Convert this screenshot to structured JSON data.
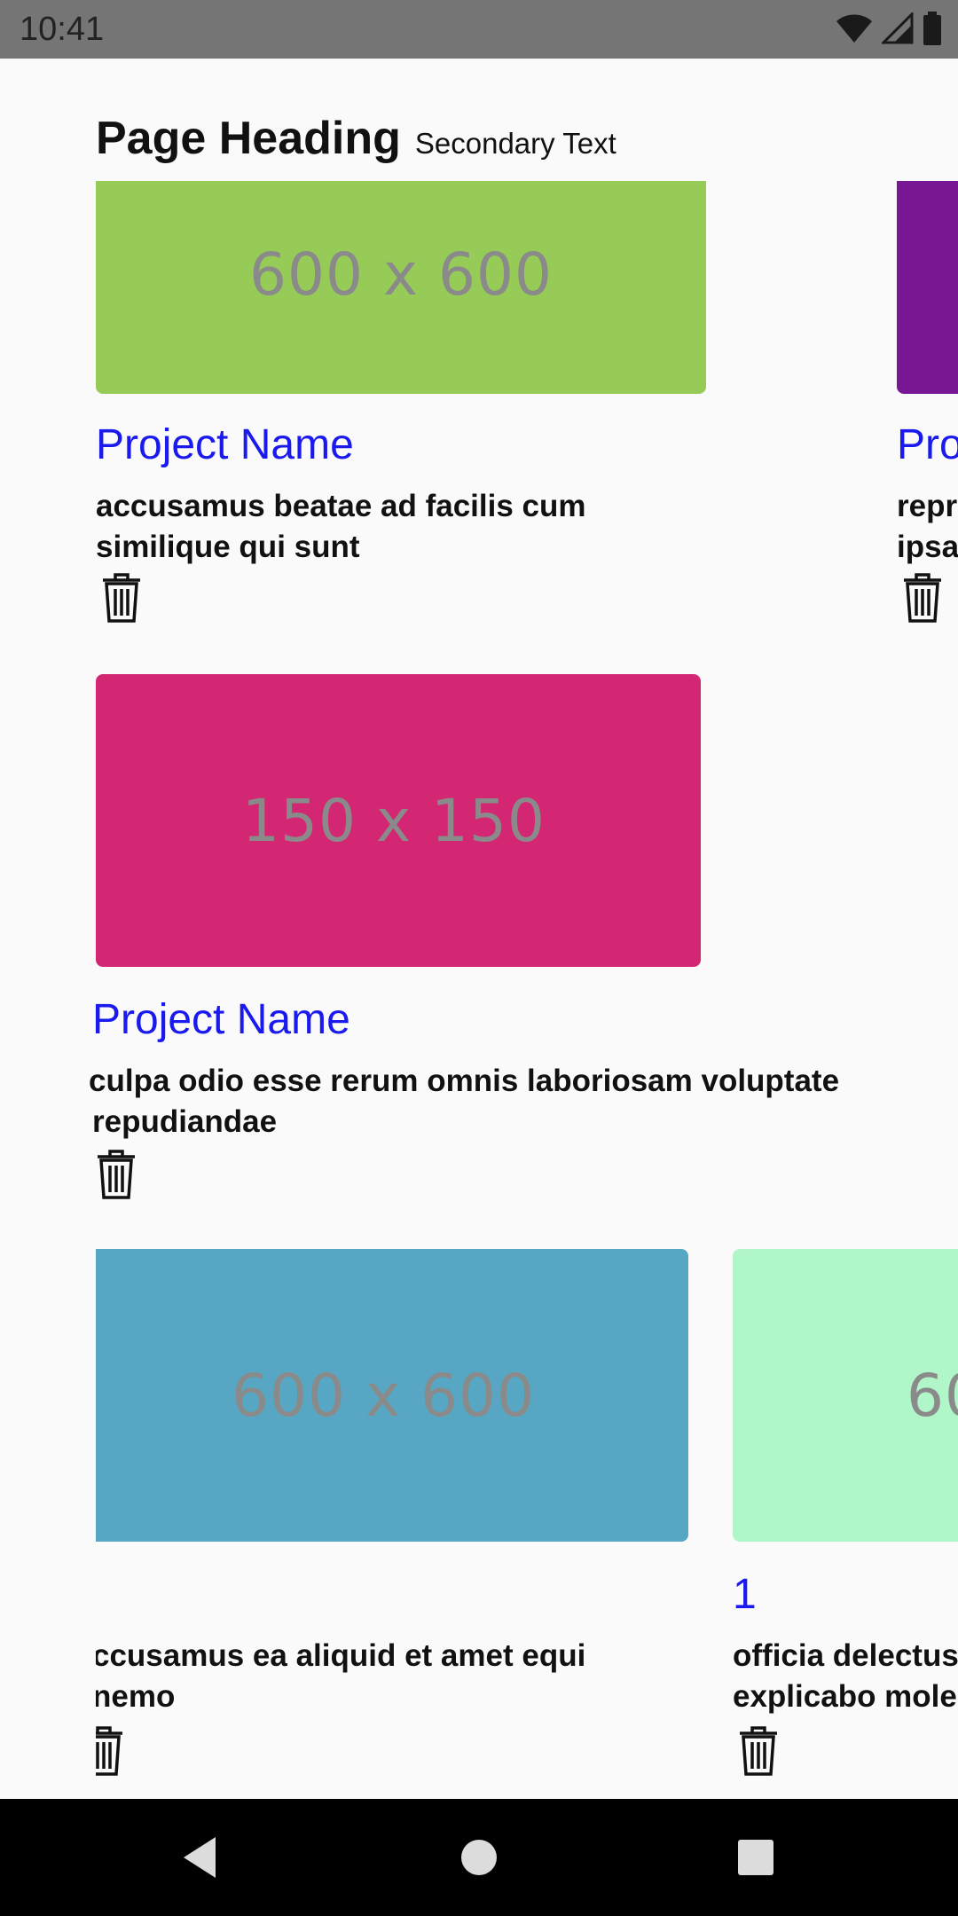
{
  "status_bar": {
    "time": "10:41",
    "icons": [
      "wifi-icon",
      "cellular-signal-icon",
      "battery-icon"
    ]
  },
  "header": {
    "heading": "Page Heading",
    "secondary": "Secondary Text"
  },
  "cards": [
    {
      "image_label": "600 x 600",
      "image_color": "#96cb57",
      "title": "Project Name",
      "description": "accusamus beatae ad facilis cum similique qui sunt",
      "icon": "trash-icon"
    },
    {
      "image_label": "",
      "image_color": "#771794",
      "title": "Pro",
      "description": "repr\nipsa",
      "icon": "trash-icon"
    },
    {
      "image_label": "150 x 150",
      "image_color": "#d42773",
      "title": "Project Name",
      "description": "culpa odio esse rerum omnis laboriosam voluptate repudiandae",
      "icon": "trash-icon"
    },
    {
      "image_label": "600 x 600",
      "image_color": "#57a7c4",
      "title": "",
      "description": "ccusamus ea aliquid et amet equi nemo",
      "icon": "trash-icon"
    },
    {
      "image_label": "60",
      "image_color": "#b0f6c8",
      "title": "1",
      "description": "officia delectus explicabo mole",
      "icon": "trash-icon"
    }
  ],
  "nav_bar": {
    "buttons": [
      "back-icon",
      "home-icon",
      "recents-icon"
    ]
  },
  "colors": {
    "status_bar_bg": "#757575",
    "page_bg": "#fafafa",
    "title_link": "#1a1aee",
    "nav_bar_bg": "#000000"
  }
}
